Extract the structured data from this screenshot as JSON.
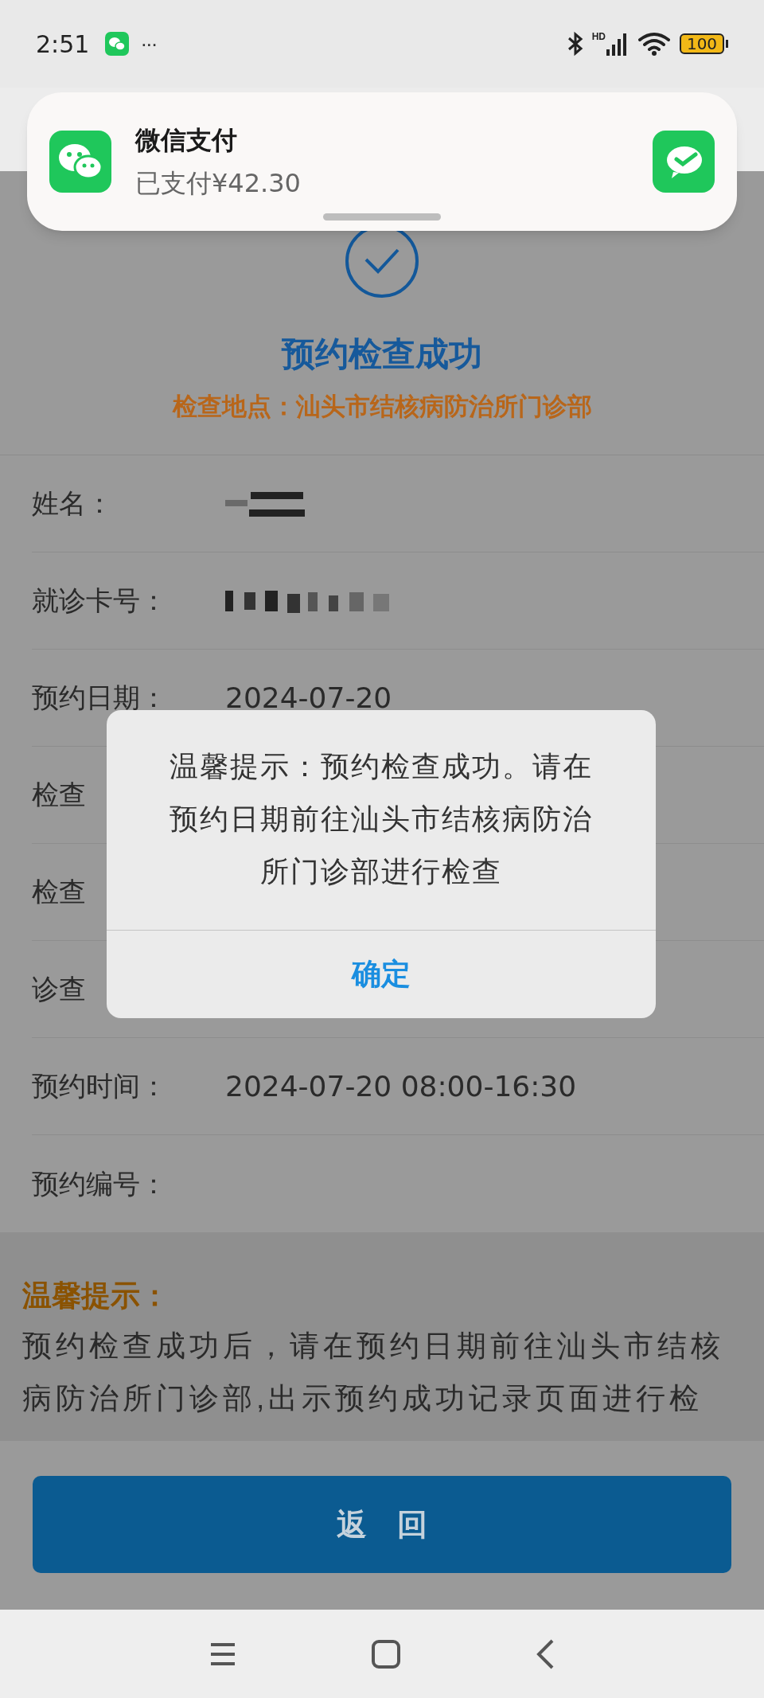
{
  "status_bar": {
    "time": "2:51",
    "more": "···",
    "network": "HD",
    "battery": "100"
  },
  "notification": {
    "title": "微信支付",
    "body": "已支付¥42.30"
  },
  "result": {
    "title": "预约检查成功",
    "location": "检查地点：汕头市结核病防治所门诊部"
  },
  "rows": [
    {
      "label": "姓名：",
      "kind": "redacted"
    },
    {
      "label": "就诊卡号：",
      "kind": "redacted"
    },
    {
      "label": "预约日期：",
      "kind": "text",
      "value": "2024-07-20"
    },
    {
      "label": "检查",
      "kind": "hidden"
    },
    {
      "label": "检查",
      "kind": "hidden"
    },
    {
      "label": "诊查",
      "kind": "hidden"
    },
    {
      "label": "预约时间：",
      "kind": "text",
      "value": "2024-07-20 08:00-16:30"
    },
    {
      "label": "预约编号：",
      "kind": "empty"
    }
  ],
  "tips": {
    "heading": "温馨提示：",
    "text": "预约检查成功后，请在预约日期前往汕头市结核病防治所门诊部,出示预约成功记录页面进行检"
  },
  "back_button": "返　回",
  "dialog": {
    "message": "温馨提示：预约检查成功。请在预约日期前往汕头市结核病防治所门诊部进行检查",
    "ok": "确定"
  }
}
